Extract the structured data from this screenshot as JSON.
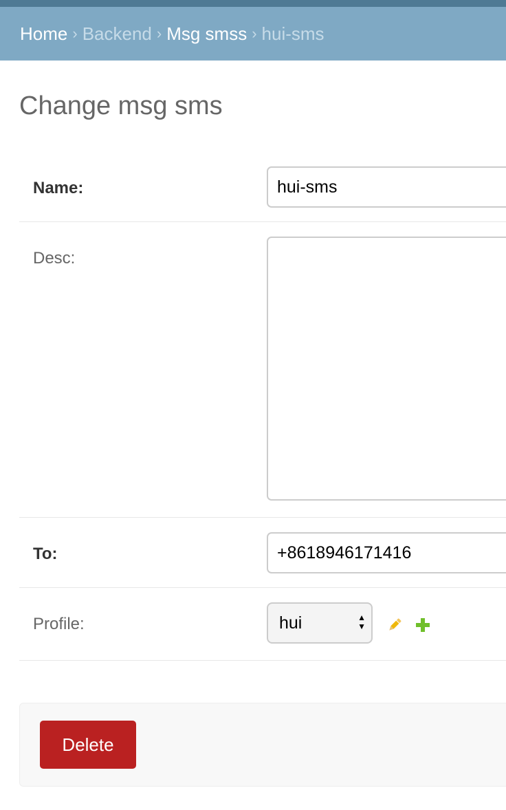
{
  "breadcrumbs": {
    "home": "Home",
    "separator": "›",
    "app": "Backend",
    "model": "Msg smss",
    "current": "hui-sms"
  },
  "page": {
    "title": "Change msg sms"
  },
  "form": {
    "name": {
      "label": "Name:",
      "value": "hui-sms"
    },
    "desc": {
      "label": "Desc:",
      "value": ""
    },
    "to": {
      "label": "To:",
      "value": "+8618946171416"
    },
    "profile": {
      "label": "Profile:",
      "selected": "hui"
    }
  },
  "actions": {
    "delete_label": "Delete"
  },
  "colors": {
    "header_dark": "#4f7a94",
    "breadcrumb_bar": "#7fa9c4",
    "delete": "#ba2121",
    "edit_icon": "#efb80b",
    "add_icon": "#70bf2b"
  },
  "icons": {
    "edit": "pencil-icon",
    "add": "plus-icon"
  }
}
